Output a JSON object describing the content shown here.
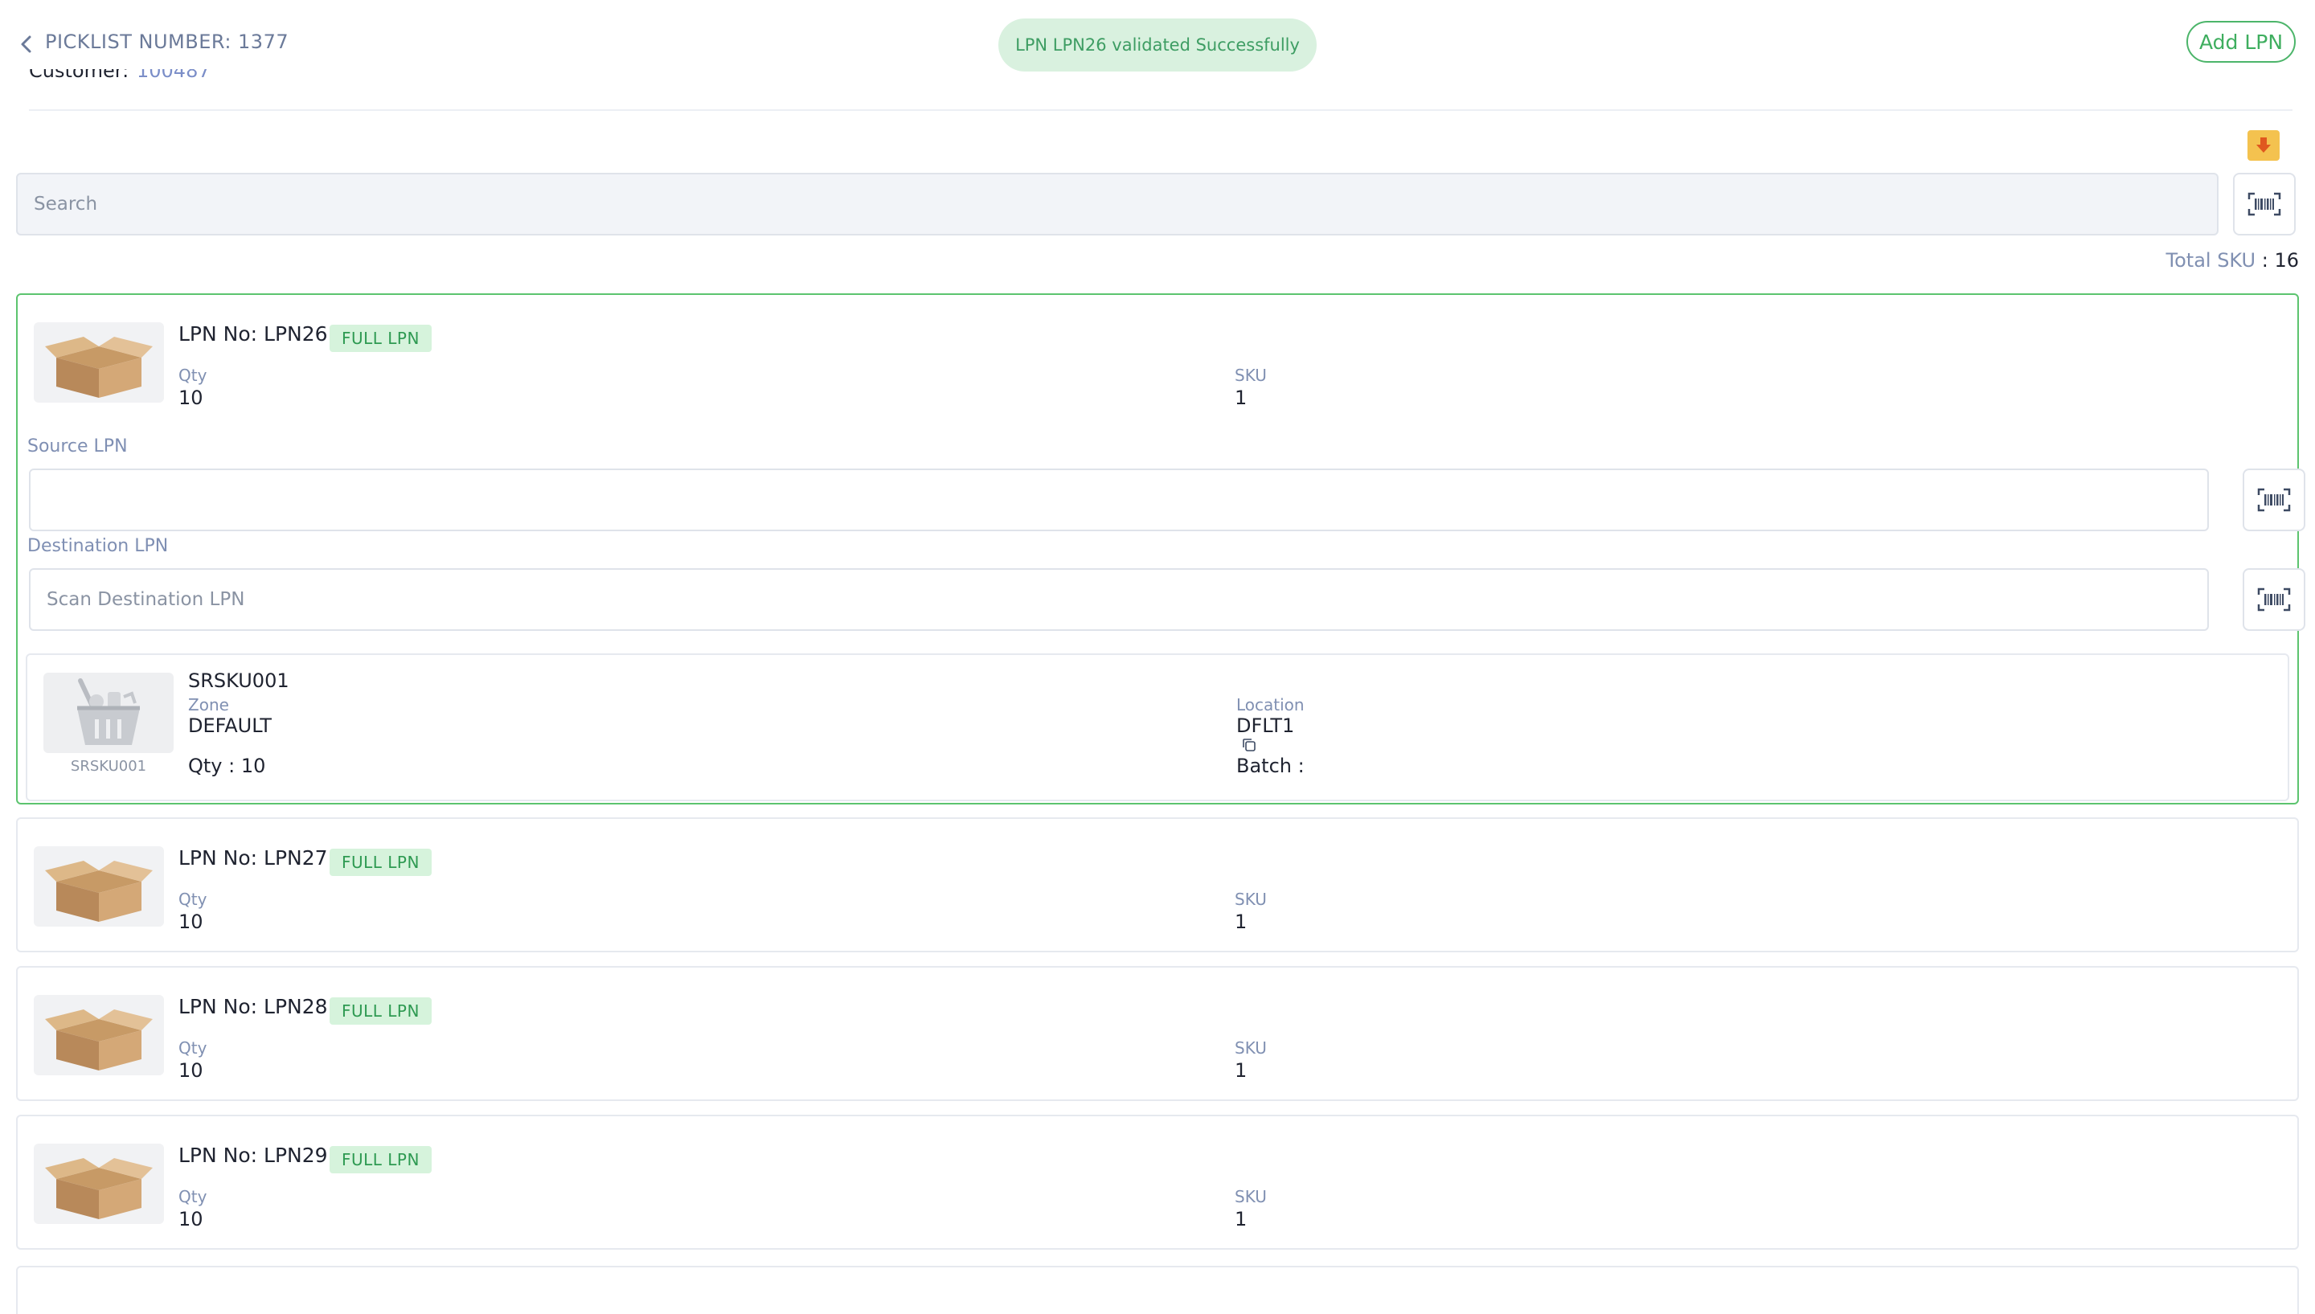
{
  "header": {
    "title": "PICKLIST NUMBER: 1377",
    "toast": "LPN LPN26 validated Successfully",
    "add_lpn_label": "Add LPN",
    "customer_label": "Customer:",
    "customer_value": "100487"
  },
  "search": {
    "placeholder": "Search"
  },
  "summary": {
    "total_sku_label": "Total SKU",
    "total_sku_value": ": 16"
  },
  "field_labels": {
    "qty": "Qty",
    "sku": "SKU",
    "source_lpn": "Source LPN",
    "destination_lpn": "Destination LPN",
    "destination_placeholder": "Scan Destination LPN",
    "zone": "Zone",
    "location": "Location",
    "qty_inline": "Qty :",
    "batch": "Batch :"
  },
  "lpns": [
    {
      "title": "LPN No: LPN26",
      "badge": "FULL LPN",
      "qty": "10",
      "sku": "1"
    },
    {
      "title": "LPN No: LPN27",
      "badge": "FULL LPN",
      "qty": "10",
      "sku": "1"
    },
    {
      "title": "LPN No: LPN28",
      "badge": "FULL LPN",
      "qty": "10",
      "sku": "1"
    },
    {
      "title": "LPN No: LPN29",
      "badge": "FULL LPN",
      "qty": "10",
      "sku": "1"
    }
  ],
  "active_lpn": {
    "source_value": "",
    "sku_item": {
      "name": "SRSKU001",
      "caption": "SRSKU001",
      "zone": "DEFAULT",
      "location": "DFLT1",
      "qty": "10",
      "batch": ""
    }
  },
  "colors": {
    "accent_green": "#4cb56a",
    "badge_bg": "#d6f3dc",
    "toast_bg": "#d9f1df",
    "label_blue": "#8090b2",
    "download_yellow": "#f4c24f"
  },
  "icons": {
    "back": "chevron-left-icon",
    "scan": "barcode-scan-icon",
    "download": "download-icon",
    "box": "cardboard-box-icon",
    "basket": "shopping-basket-icon",
    "copy": "copy-icon"
  }
}
